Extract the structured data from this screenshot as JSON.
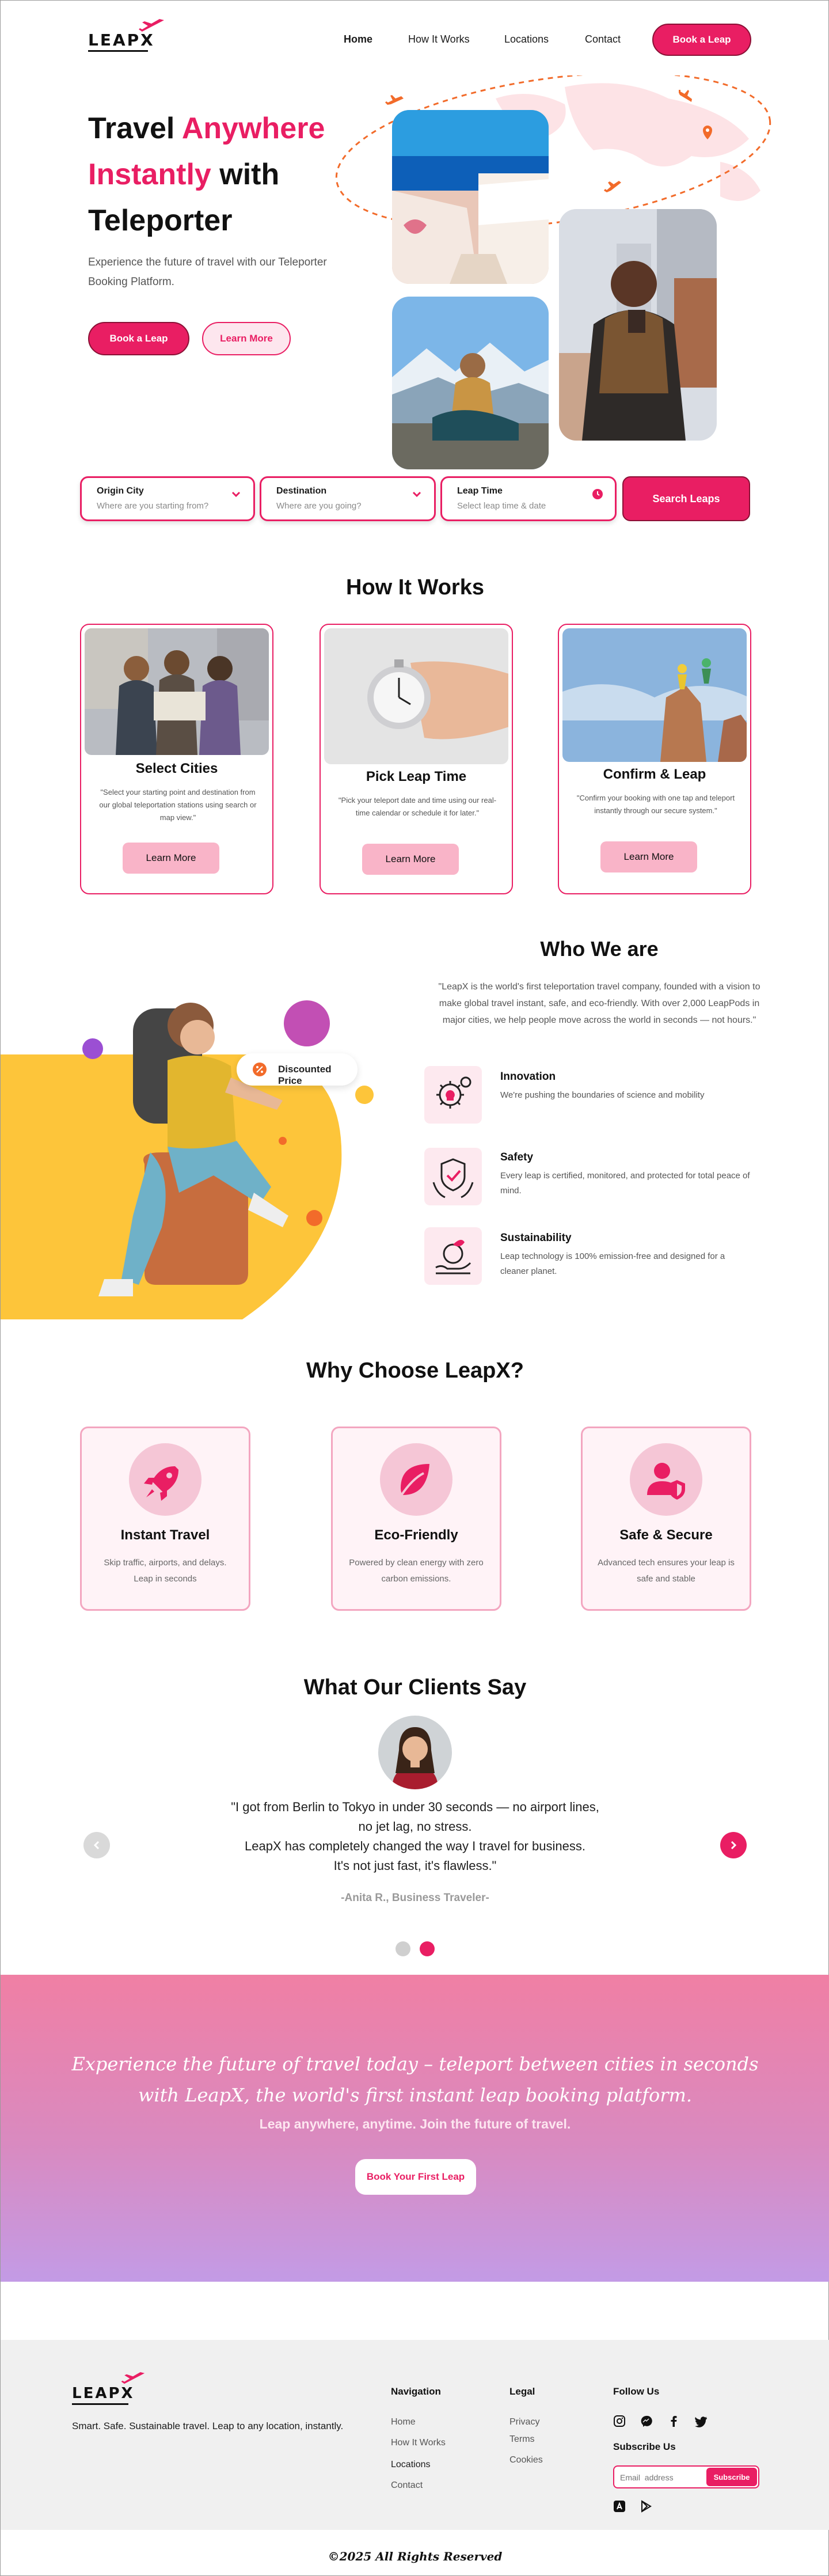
{
  "brand": {
    "name": "LEAPX",
    "accent": "#e91e63"
  },
  "nav": {
    "items": [
      {
        "label": "Home",
        "active": true
      },
      {
        "label": "How It Works",
        "active": false
      },
      {
        "label": "Locations",
        "active": false
      },
      {
        "label": "Contact",
        "active": false
      }
    ],
    "cta": "Book a Leap"
  },
  "hero": {
    "title_1": "Travel ",
    "title_2": "Anywhere",
    "title_3": "Instantly",
    "title_4": " with",
    "title_5": "Teleporter",
    "subtitle": "Experience the future of travel with our Teleporter Booking Platform.",
    "primary_button": "Book a Leap",
    "secondary_button": "Learn More"
  },
  "search": {
    "origin": {
      "label": "Origin City",
      "placeholder": "Where are you starting from?"
    },
    "destination": {
      "label": "Destination",
      "placeholder": "Where are you going?"
    },
    "time": {
      "label": "Leap Time",
      "placeholder": "Select leap time & date"
    },
    "button": "Search Leaps"
  },
  "how": {
    "title": "How It Works",
    "cards": [
      {
        "title": "Select Cities",
        "desc": "\"Select your starting point and destination from our global teleportation stations using search or map view.\"",
        "button": "Learn More"
      },
      {
        "title": "Pick Leap Time",
        "desc": "\"Pick your teleport date and time using our real-time calendar or schedule it for later.\"",
        "button": "Learn More"
      },
      {
        "title": "Confirm & Leap",
        "desc": "\"Confirm your booking with one tap and teleport instantly through our secure system.\"",
        "button": "Learn More"
      }
    ]
  },
  "who": {
    "title": "Who We are",
    "para": "\"LeapX is the world's first teleportation travel company, founded with a vision to make global travel instant, safe, and eco-friendly. With over 2,000 LeapPods in major cities, we help people move across the world in seconds — not hours.\"",
    "badge": "Discounted Price",
    "features": [
      {
        "title": "Innovation",
        "desc": "We're pushing the boundaries of science and mobility",
        "icon": "gear-bulb-icon"
      },
      {
        "title": "Safety",
        "desc": "Every leap is certified, monitored, and protected for total peace of mind.",
        "icon": "shield-hands-icon"
      },
      {
        "title": "Sustainability",
        "desc": "Leap technology is 100% emission-free and designed for a cleaner planet.",
        "icon": "eco-globe-icon"
      }
    ]
  },
  "why": {
    "title": "Why Choose LeapX?",
    "cards": [
      {
        "title": "Instant Travel",
        "desc": "Skip traffic, airports, and delays. Leap in seconds",
        "icon": "rocket-icon"
      },
      {
        "title": "Eco-Friendly",
        "desc": "Powered by clean energy with zero carbon emissions.",
        "icon": "leaf-icon"
      },
      {
        "title": "Safe & Secure",
        "desc": "Advanced tech ensures your leap is safe and stable",
        "icon": "user-shield-icon"
      }
    ]
  },
  "testimonials": {
    "title": "What Our Clients Say",
    "quote_1": "\"I got from Berlin to Tokyo in under 30 seconds — no airport lines,",
    "quote_2": "no jet lag, no stress.",
    "quote_3": "LeapX has completely changed the way I travel for business.",
    "quote_4": "It's not just fast, it's flawless.\"",
    "author": "-Anita R., Business Traveler-",
    "active_index": 1,
    "count": 2
  },
  "cta": {
    "line_1": "Experience the future of travel today – teleport between cities in seconds",
    "line_2": "with LeapX, the world's first instant leap booking platform.",
    "sub": "Leap anywhere, anytime. Join the future of travel.",
    "button": "Book Your First Leap"
  },
  "footer": {
    "tagline": "Smart. Safe. Sustainable travel. Leap to any location, instantly.",
    "nav_title": "Navigation",
    "nav_links": [
      "Home",
      "How It Works",
      "Locations",
      "Contact"
    ],
    "legal_title": "Legal",
    "legal_links": [
      "Privacy",
      "Terms",
      "Cookies"
    ],
    "follow_title": "Follow Us",
    "subscribe_title": "Subscribe Us",
    "email_placeholder": "Email  address",
    "subscribe_button": "Subscribe",
    "copyright": "©2025 All Rights Reserved"
  }
}
